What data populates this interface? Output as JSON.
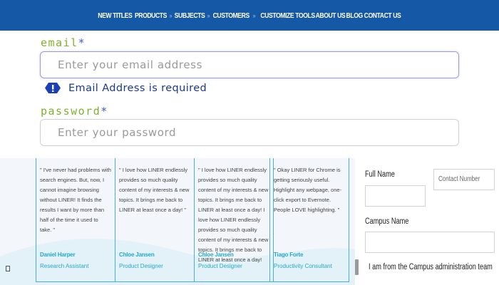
{
  "nav": {
    "items": [
      {
        "label": "NEW TITLES"
      },
      {
        "label": "PRODUCTS",
        "sep_after": "»"
      },
      {
        "label": "SUBJECTS",
        "sep_after": "»"
      },
      {
        "label": "CUSTOMERS",
        "sep_after": "»"
      },
      {
        "label": "CUSTOMIZE TOOLS"
      },
      {
        "label": "ABOUT US"
      },
      {
        "label": "BLOG"
      },
      {
        "label": "CONTACT US"
      }
    ]
  },
  "login": {
    "email_label": "email",
    "email_required_mark": "*",
    "email_placeholder": "Enter your email address",
    "email_error": "Email Address is required",
    "password_label": "password",
    "password_required_mark": "*",
    "password_placeholder": "Enter your password",
    "error_icon": "alert-badge-icon",
    "colors": {
      "label": "#7bb22d",
      "star": "#3a5fc0",
      "error": "#1b3a8c",
      "focus_border": "#9b9be0"
    }
  },
  "testimonials": [
    {
      "quote": "\" I've never had problems with search engines. But, now, I cannot imagine browsing without LINER! It finds the results I want by more than half of the time it used to take. \"",
      "name": "Daniel Harper",
      "role": "Research Assistant"
    },
    {
      "quote": "\" I love how LINER endlessly provides so much quality content of my interests & new topics. It brings me back to LINER at least once a day! \"",
      "name": "Chloe Jansen",
      "role": "Product Designer"
    },
    {
      "quote": "\" I love how LINER endlessly provides so much quality content of my interests & new topics. It brings me back to LINER at least once a day! I love how LINER endlessly provides so much quality content of my interests & new topics. It brings me back to LINER at least once a day!",
      "name": "Chloe Jansen",
      "role": "Product Designer"
    },
    {
      "quote": "\" Okay LINER for Chrome is getting seriously useful. Highlight any webpage, one-click export to Evernote. People LOVE highlighting. \"",
      "name": "Tiago Forte",
      "role": "Productivity Consultant"
    }
  ],
  "sideform": {
    "full_name_label": "Full Name",
    "contact_placeholder": "Contact Number",
    "campus_label": "Campus Name",
    "checkbox_label": "I am from the Campus administration team"
  },
  "accent": {
    "nav_bg": "#1458a6",
    "testimonial_accent": "#26a9c8"
  }
}
